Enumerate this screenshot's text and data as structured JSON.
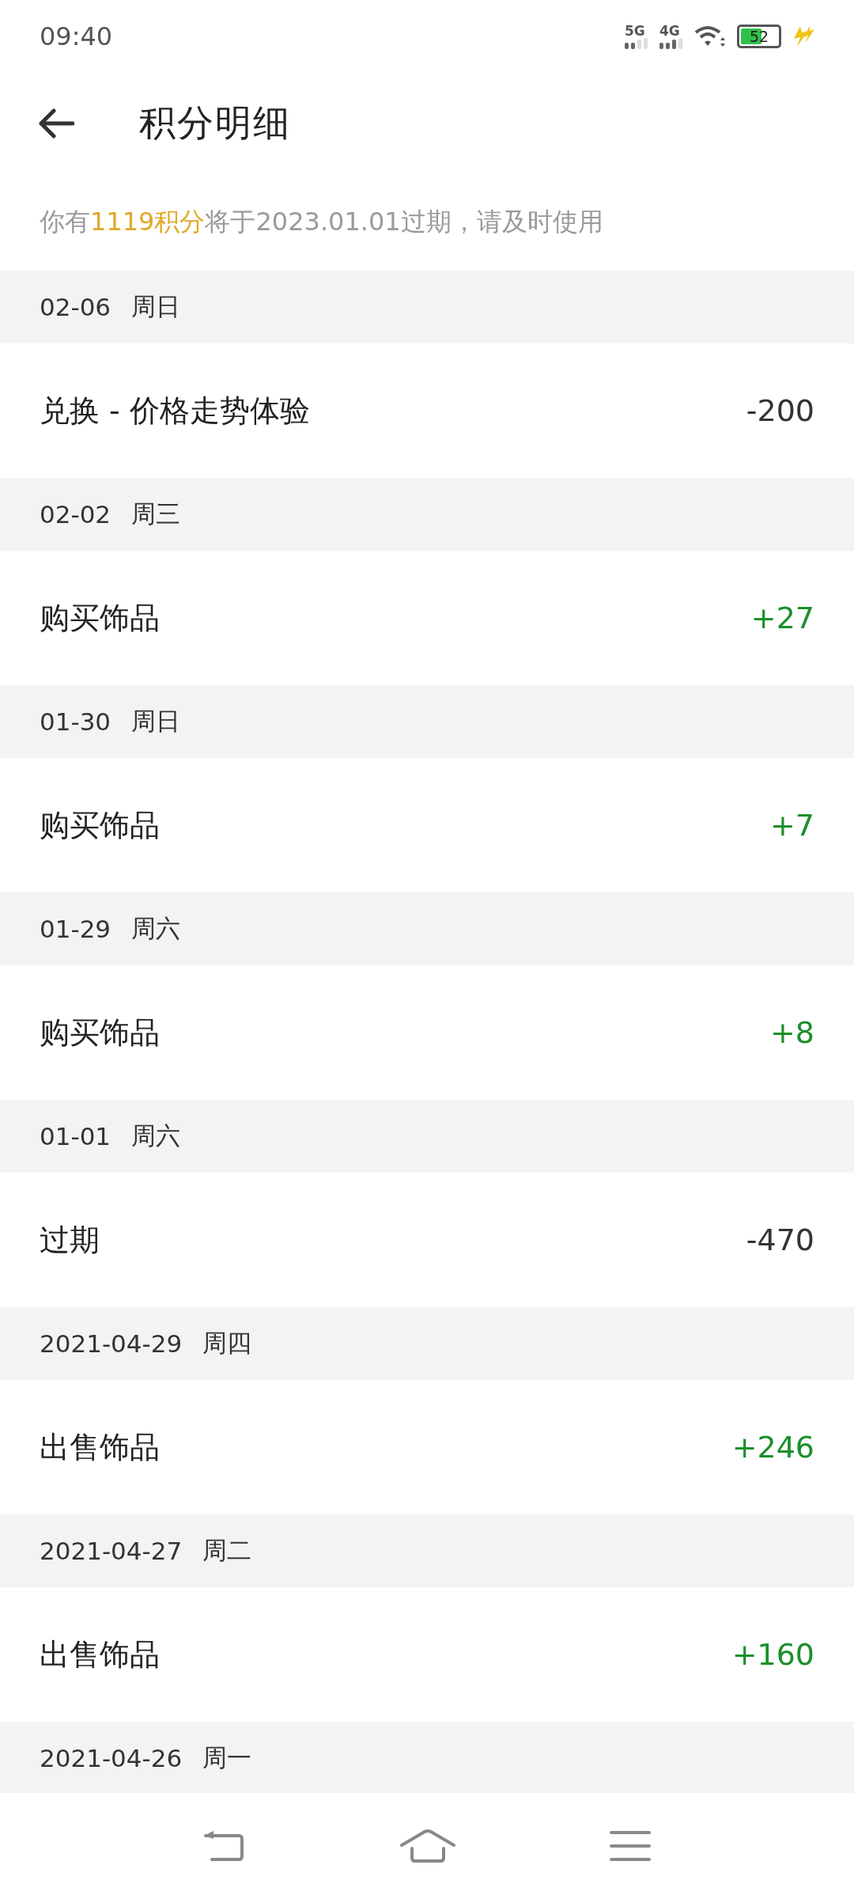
{
  "status_bar": {
    "time": "09:40",
    "network_1": "5G",
    "network_2": "4G",
    "battery": "52"
  },
  "header": {
    "title": "积分明细"
  },
  "notice": "你有**1119积分**将于2023.01.01过期，请及时使用",
  "groups": [
    {
      "date": "02-06",
      "weekday": "周日",
      "entries": [
        {
          "title": "兑换 - 价格走势体验",
          "amount": "-200",
          "positive": false
        }
      ]
    },
    {
      "date": "02-02",
      "weekday": "周三",
      "entries": [
        {
          "title": "购买饰品",
          "amount": "+27",
          "positive": true
        }
      ]
    },
    {
      "date": "01-30",
      "weekday": "周日",
      "entries": [
        {
          "title": "购买饰品",
          "amount": "+7",
          "positive": true
        }
      ]
    },
    {
      "date": "01-29",
      "weekday": "周六",
      "entries": [
        {
          "title": "购买饰品",
          "amount": "+8",
          "positive": true
        }
      ]
    },
    {
      "date": "01-01",
      "weekday": "周六",
      "entries": [
        {
          "title": "过期",
          "amount": "-470",
          "positive": false
        }
      ]
    },
    {
      "date": "2021-04-29",
      "weekday": "周四",
      "entries": [
        {
          "title": "出售饰品",
          "amount": "+246",
          "positive": true
        }
      ]
    },
    {
      "date": "2021-04-27",
      "weekday": "周二",
      "entries": [
        {
          "title": "出售饰品",
          "amount": "+160",
          "positive": true
        }
      ]
    },
    {
      "date": "2021-04-26",
      "weekday": "周一"
    }
  ]
}
